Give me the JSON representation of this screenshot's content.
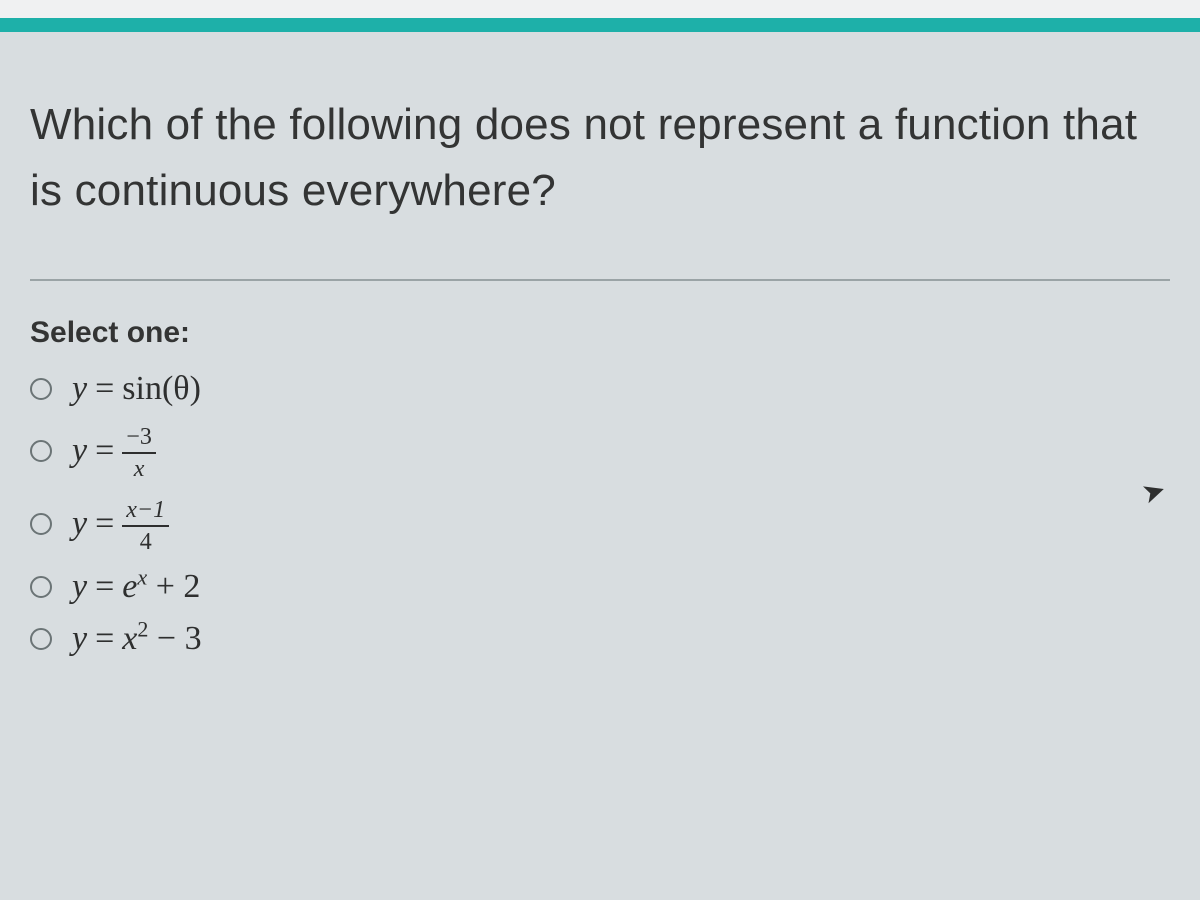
{
  "header": {
    "bars": [
      "white",
      "teal"
    ]
  },
  "question": "Which of the following does not represent a function that is continuous everywhere?",
  "select_label": "Select one:",
  "options": [
    {
      "lhs": "y",
      "eq": "=",
      "rhs_plain": "sin(θ)"
    },
    {
      "lhs": "y",
      "eq": "=",
      "frac_num": "−3",
      "frac_den": "x"
    },
    {
      "lhs": "y",
      "eq": "=",
      "frac_num": "x−1",
      "frac_den": "4"
    },
    {
      "lhs": "y",
      "eq": "=",
      "rhs_base": "e",
      "rhs_exp": "x",
      "rhs_tail": " + 2"
    },
    {
      "lhs": "y",
      "eq": "=",
      "rhs_base": "x",
      "rhs_exp": "2",
      "rhs_tail": " − 3"
    }
  ],
  "cursor_glyph": "➤"
}
